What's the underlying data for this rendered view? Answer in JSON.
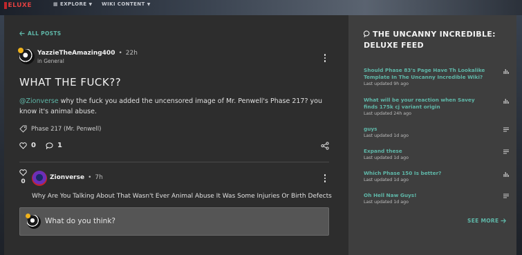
{
  "topbar": {
    "logo_text": "ELUXE",
    "nav": [
      {
        "label": "EXPLORE"
      },
      {
        "label": "WIKI CONTENT"
      }
    ]
  },
  "post": {
    "back_label": "ALL POSTS",
    "author": "YazzieTheAmazing400",
    "time": "22h",
    "category": "in General",
    "title": "WHAT THE FUCK??",
    "body_mention": "@Zionverse",
    "body_text": " why the fuck you added the uncensored image of Mr. Penwell's Phase 217? you know it's animal abuse.",
    "tag": "Phase 217 (Mr. Penwell)",
    "likes": "0",
    "comments": "1"
  },
  "reply": {
    "author": "Zionverse",
    "time": "7h",
    "likes": "0",
    "text": "Why Are You Talking About That Wasn't Ever Animal Abuse It Was Some Injuries Or Birth Defects"
  },
  "composer": {
    "placeholder": "What do you think?"
  },
  "feed": {
    "title": "THE UNCANNY INCREDIBLE: DELUXE FEED",
    "items": [
      {
        "title": "Should Phase 83's Page Have Th Lookalike Template In The Uncanny Incredible Wiki?",
        "updated": "Last updated 9h ago",
        "icon": "poll-icon"
      },
      {
        "title": "What will be your reaction when Savey finds 175k cj variant origin",
        "updated": "Last updated 24h ago",
        "icon": "poll-icon"
      },
      {
        "title": "guys",
        "updated": "Last updated 1d ago",
        "icon": "text-icon"
      },
      {
        "title": "Expand these",
        "updated": "Last updated 1d ago",
        "icon": "text-icon"
      },
      {
        "title": "Which Phase 150 Is better?",
        "updated": "Last updated 1d ago",
        "icon": "poll-icon"
      },
      {
        "title": "Oh Hell Naw Guys!",
        "updated": "Last updated 1d ago",
        "icon": "text-icon"
      }
    ],
    "see_more": "SEE MORE"
  },
  "colors": {
    "accent": "#5fb7a8",
    "brand_red": "#c0262b",
    "main_bg": "#2d2d2d",
    "side_bg": "#3e3e3e"
  }
}
